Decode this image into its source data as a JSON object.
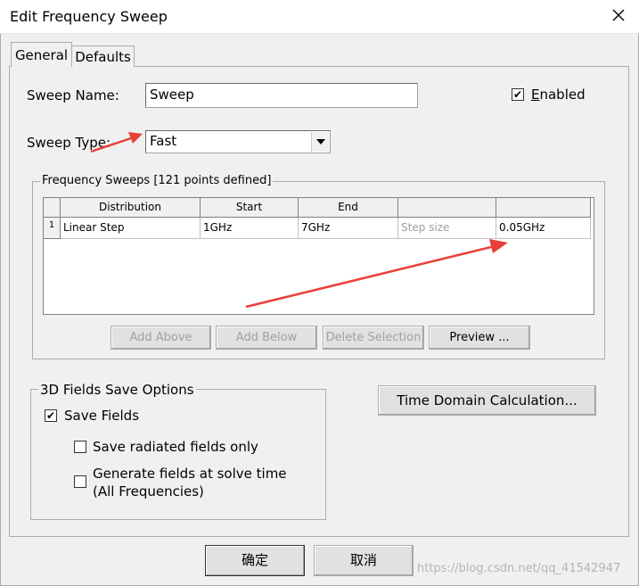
{
  "window": {
    "title": "Edit Frequency Sweep"
  },
  "tabs": [
    {
      "label": "General",
      "active": true
    },
    {
      "label": "Defaults",
      "active": false
    }
  ],
  "general": {
    "sweep_name_label": "Sweep Name:",
    "sweep_name_value": "Sweep",
    "enabled_label": "Enabled",
    "enabled_checked": true,
    "sweep_type_label": "Sweep Type:",
    "sweep_type_value": "Fast"
  },
  "frequency_sweeps": {
    "legend": "Frequency Sweeps [121 points defined]",
    "columns": [
      "Distribution",
      "Start",
      "End",
      "",
      ""
    ],
    "rows": [
      {
        "index": "1",
        "distribution": "Linear Step",
        "start": "1GHz",
        "end": "7GHz",
        "step_label": "Step size",
        "step_value": "0.05GHz"
      }
    ],
    "buttons": {
      "add_above": "Add Above",
      "add_below": "Add Below",
      "delete_selection": "Delete Selection",
      "preview": "Preview ..."
    }
  },
  "fields_save": {
    "legend": "3D Fields Save Options",
    "save_fields": "Save Fields",
    "save_fields_checked": true,
    "save_radiated": "Save radiated fields only",
    "save_radiated_checked": false,
    "generate_line1": "Generate fields at solve time",
    "generate_line2": "(All Frequencies)",
    "generate_checked": false
  },
  "time_domain_button": "Time Domain Calculation...",
  "footer": {
    "ok": "确定",
    "cancel": "取消"
  },
  "watermark": "https://blog.csdn.net/qq_41542947",
  "colors": {
    "annotation_arrow": "#e8403a",
    "disabled_text": "#a0a0a0"
  }
}
